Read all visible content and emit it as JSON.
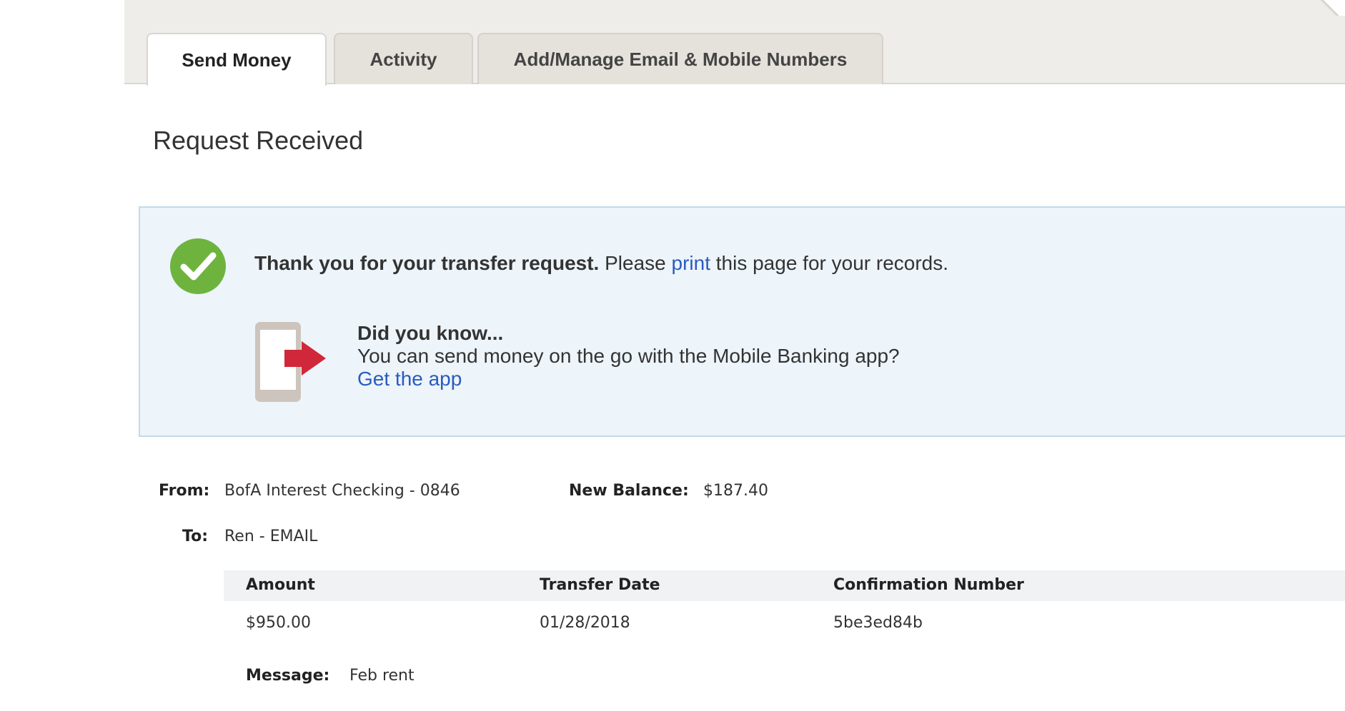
{
  "tabs": [
    {
      "label": "Send Money",
      "active": true
    },
    {
      "label": "Activity",
      "active": false
    },
    {
      "label": "Add/Manage Email & Mobile Numbers",
      "active": false
    }
  ],
  "page_title": "Request Received",
  "notice": {
    "thanks_bold": "Thank you for your transfer request.",
    "thanks_pre": " Please ",
    "print_link": "print",
    "thanks_post": " this page for your records.",
    "tip_heading": "Did you know...",
    "tip_text": "You can send money on the go with the Mobile Banking app?",
    "get_app_link": "Get the app"
  },
  "details": {
    "from_label": "From:",
    "from_value": "BofA Interest Checking - 0846",
    "balance_label": "New Balance:",
    "balance_value": "$187.40",
    "to_label": "To:",
    "to_value": "Ren - EMAIL"
  },
  "transfer_table": {
    "headers": [
      "Amount",
      "Transfer Date",
      "Confirmation Number"
    ],
    "row": [
      "$950.00",
      "01/28/2018",
      "5be3ed84b"
    ]
  },
  "message": {
    "label": "Message:",
    "value": "Feb rent"
  },
  "colors": {
    "link": "#2a5bbf",
    "success_green": "#6fb33f",
    "arrow_red": "#d0283a",
    "notice_bg": "#edf4fa"
  },
  "icons": {
    "success": "check-circle-icon",
    "mobile": "mobile-app-icon"
  }
}
